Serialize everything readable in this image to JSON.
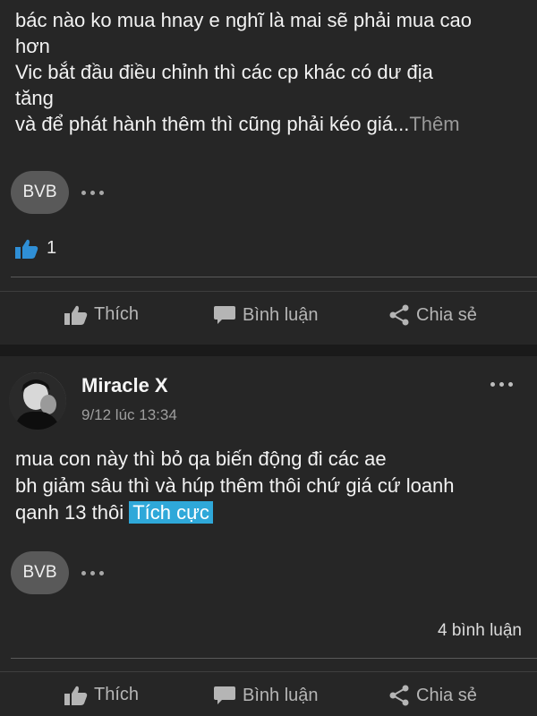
{
  "post1": {
    "lines": [
      "bác nào ko mua hnay e nghĩ là mai sẽ phải mua cao",
      "hơn",
      "Vic bắt đầu điều chỉnh thì các cp khác có dư địa",
      "tăng",
      "và để phát hành thêm thì cũng phải kéo giá..."
    ],
    "more_label": "Thêm",
    "tag": "BVB",
    "like_count": "1",
    "actions": {
      "like": "Thích",
      "comment": "Bình luận",
      "share": "Chia sẻ"
    }
  },
  "post2": {
    "author": "Miracle X",
    "time": "9/12 lúc 13:34",
    "lines": [
      "mua con này thì bỏ qa biến động đi các ae",
      "bh giảm sâu thì và húp thêm thôi chứ giá cứ loanh",
      "qanh 13 thôi "
    ],
    "sentiment": "Tích cực",
    "tag": "BVB",
    "comment_count": "4 bình luận",
    "actions": {
      "like": "Thích",
      "comment": "Bình luận",
      "share": "Chia sẻ"
    }
  },
  "colors": {
    "background": "#1a1a1a",
    "card": "#262626",
    "like_blue": "#2f8fd6",
    "sentiment_highlight": "#2fa8d9"
  }
}
